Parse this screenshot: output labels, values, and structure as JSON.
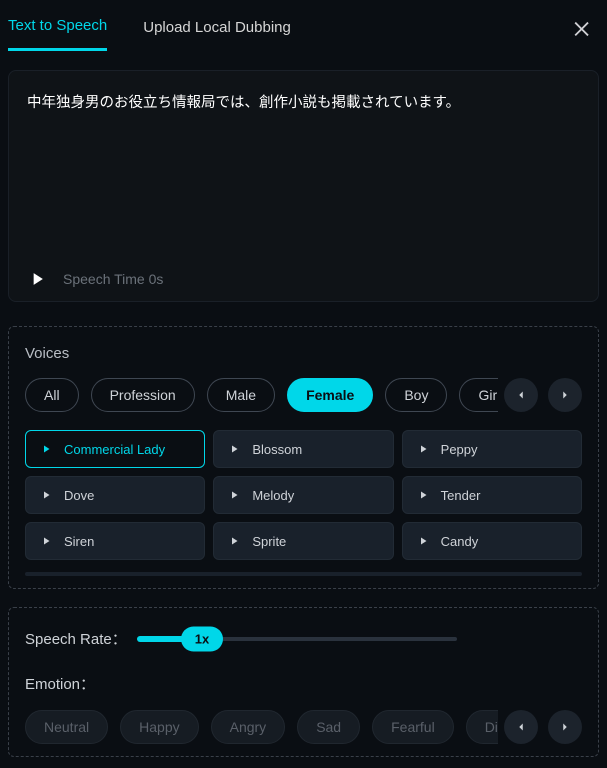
{
  "tabs": {
    "tts": "Text to Speech",
    "upload": "Upload Local Dubbing",
    "active": "tts"
  },
  "textarea": {
    "content": "中年独身男のお役立ち情報局では、創作小説も掲載されています。"
  },
  "speech_time_label": "Speech Time 0s",
  "voices": {
    "title": "Voices",
    "filters": [
      "All",
      "Profession",
      "Male",
      "Female",
      "Boy",
      "Girl"
    ],
    "active_filter": "Female",
    "list": [
      "Commercial Lady",
      "Blossom",
      "Peppy",
      "Dove",
      "Melody",
      "Tender",
      "Siren",
      "Sprite",
      "Candy"
    ],
    "selected": "Commercial Lady"
  },
  "rate": {
    "label": "Speech Rate：",
    "value": "1x"
  },
  "emotion": {
    "label": "Emotion：",
    "options": [
      "Neutral",
      "Happy",
      "Angry",
      "Sad",
      "Fearful",
      "Disgusted"
    ]
  }
}
